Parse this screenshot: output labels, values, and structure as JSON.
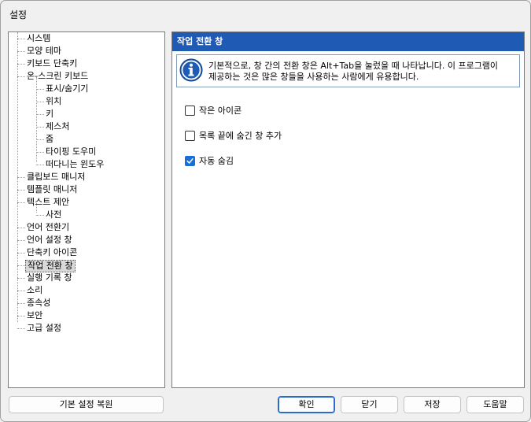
{
  "window": {
    "title": "설정"
  },
  "tree": {
    "items": [
      {
        "label": "시스템",
        "level": 0
      },
      {
        "label": "모양 테마",
        "level": 0
      },
      {
        "label": "키보드 단축키",
        "level": 0
      },
      {
        "label": "온-스크린 키보드",
        "level": 0
      },
      {
        "label": "표시/숨기기",
        "level": 1
      },
      {
        "label": "위치",
        "level": 1
      },
      {
        "label": "키",
        "level": 1
      },
      {
        "label": "제스처",
        "level": 1
      },
      {
        "label": "줌",
        "level": 1
      },
      {
        "label": "타이핑 도우미",
        "level": 1
      },
      {
        "label": "떠다니는 윈도우",
        "level": 1
      },
      {
        "label": "클립보드 매니저",
        "level": 0
      },
      {
        "label": "템플릿 매니저",
        "level": 0
      },
      {
        "label": "텍스트 제안",
        "level": 0
      },
      {
        "label": "사전",
        "level": 1
      },
      {
        "label": "언어 전환기",
        "level": 0
      },
      {
        "label": "언어 설정 창",
        "level": 0
      },
      {
        "label": "단축키 아이콘",
        "level": 0
      },
      {
        "label": "작업 전환 창",
        "level": 0,
        "selected": true
      },
      {
        "label": "실행 기록 창",
        "level": 0
      },
      {
        "label": "소리",
        "level": 0
      },
      {
        "label": "종속성",
        "level": 0
      },
      {
        "label": "보안",
        "level": 0
      },
      {
        "label": "고급 설정",
        "level": 0
      }
    ]
  },
  "panel": {
    "header": "작업 전환 창",
    "info_line1": "기본적으로, 창 간의 전환 창은 Alt+Tab을 눌렀을 때 나타납니다. 이 프로그램이",
    "info_line2": "제공하는 것은 많은 창들을 사용하는 사람에게 유용합니다.",
    "options": [
      {
        "label": "작은 아이콘",
        "checked": false
      },
      {
        "label": "목록 끝에 숨긴 창 추가",
        "checked": false
      },
      {
        "label": "자동 숨김",
        "checked": true
      }
    ]
  },
  "buttons": {
    "restore": "기본 설정 복원",
    "ok": "확인",
    "close": "닫기",
    "save": "저장",
    "help": "도움말"
  },
  "colors": {
    "header_bg": "#1f5bb5",
    "check_accent": "#1a6fd6"
  }
}
